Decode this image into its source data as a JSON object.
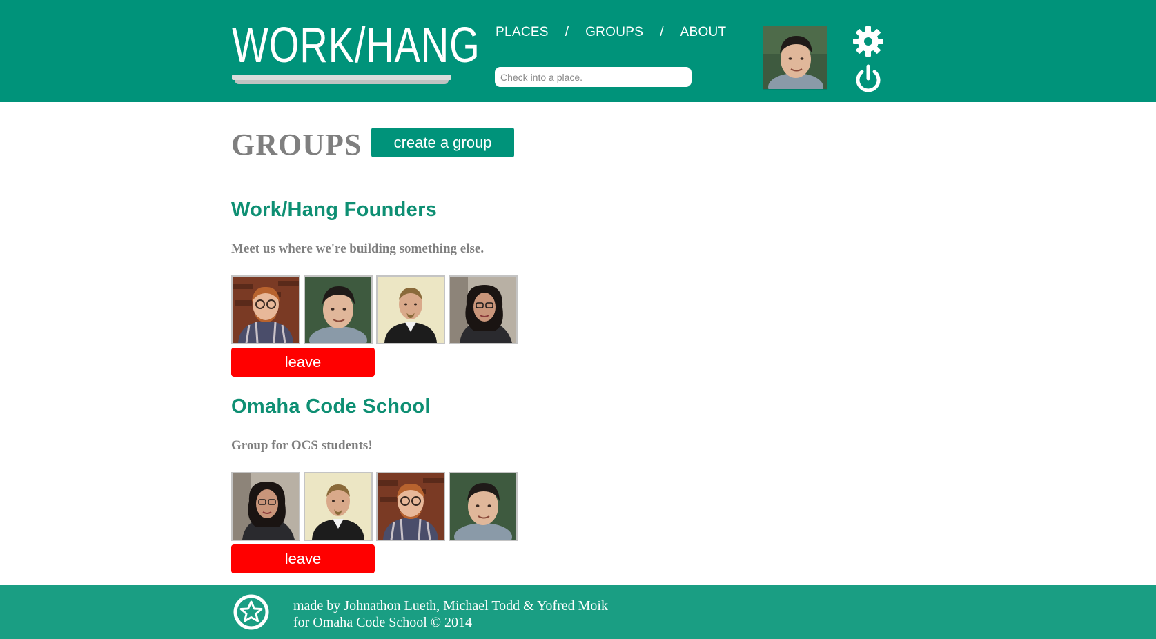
{
  "header": {
    "logo_text": "WORK/HANG",
    "nav": [
      {
        "label": "PLACES"
      },
      {
        "label": "GROUPS"
      },
      {
        "label": "ABOUT"
      }
    ],
    "nav_separator": "/",
    "search_placeholder": "Check into a place.",
    "brand_color": "#00937a"
  },
  "main": {
    "title": "GROUPS",
    "create_label": "create a group",
    "groups": [
      {
        "name": "Work/Hang Founders",
        "description": "Meet us where we're building something else.",
        "members": [
          "redhead-glasses",
          "dark-hair",
          "blond-goatee",
          "curly-glasses"
        ],
        "leave_label": "leave"
      },
      {
        "name": "Omaha Code School",
        "description": "Group for OCS students!",
        "members": [
          "curly-glasses",
          "blond-goatee",
          "redhead-glasses",
          "dark-hair"
        ],
        "leave_label": "leave"
      }
    ]
  },
  "footer": {
    "line1": "made by Johnathon Lueth, Michael Todd & Yofred Moik",
    "line2": "for Omaha Code School © 2014"
  },
  "colors": {
    "accent": "#00937a",
    "footer": "#1a9e83",
    "danger": "#ff0000",
    "heading_gray": "#7f7f7f"
  },
  "icons": [
    "gear-icon",
    "power-icon",
    "star-badge-icon"
  ]
}
